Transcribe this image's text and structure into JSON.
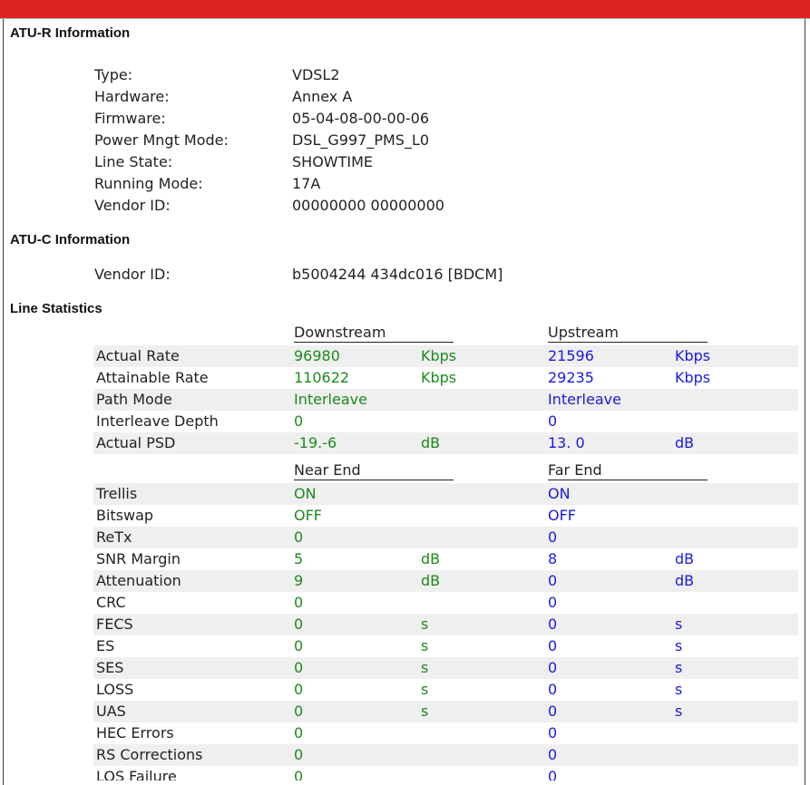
{
  "sections": {
    "atur_title": "ATU-R Information",
    "atuc_title": "ATU-C Information",
    "line_title": "Line Statistics"
  },
  "atur": [
    {
      "label": "Type:",
      "value": "VDSL2"
    },
    {
      "label": "Hardware:",
      "value": "Annex A"
    },
    {
      "label": "Firmware:",
      "value": "05-04-08-00-00-06"
    },
    {
      "label": "Power Mngt Mode:",
      "value": "DSL_G997_PMS_L0"
    },
    {
      "label": "Line State:",
      "value": "SHOWTIME"
    },
    {
      "label": "Running Mode:",
      "value": "17A"
    },
    {
      "label": "Vendor ID:",
      "value": "00000000 00000000"
    }
  ],
  "atuc": [
    {
      "label": "Vendor ID:",
      "value": "b5004244 434dc016 [BDCM]"
    }
  ],
  "stats_header1": {
    "left": "Downstream",
    "right": "Upstream"
  },
  "stats_rows1": [
    {
      "label": "Actual Rate",
      "v1": "96980",
      "u1": "Kbps",
      "v2": "21596",
      "u2": "Kbps"
    },
    {
      "label": "Attainable Rate",
      "v1": "110622",
      "u1": "Kbps",
      "v2": "29235",
      "u2": "Kbps"
    },
    {
      "label": "Path Mode",
      "v1": "Interleave",
      "u1": "",
      "v2": "Interleave",
      "u2": ""
    },
    {
      "label": "Interleave Depth",
      "v1": "0",
      "u1": "",
      "v2": "0",
      "u2": ""
    },
    {
      "label": "Actual PSD",
      "v1": "-19.-6",
      "u1": "dB",
      "v2": "13. 0",
      "u2": "dB"
    }
  ],
  "stats_header2": {
    "left": "Near End",
    "right": "Far End"
  },
  "stats_rows2": [
    {
      "label": "Trellis",
      "v1": "ON",
      "u1": "",
      "v2": "ON",
      "u2": ""
    },
    {
      "label": "Bitswap",
      "v1": "OFF",
      "u1": "",
      "v2": "OFF",
      "u2": ""
    },
    {
      "label": "ReTx",
      "v1": "0",
      "u1": "",
      "v2": "0",
      "u2": ""
    },
    {
      "label": "SNR Margin",
      "v1": "5",
      "u1": "dB",
      "v2": "8",
      "u2": "dB"
    },
    {
      "label": "Attenuation",
      "v1": "9",
      "u1": "dB",
      "v2": "0",
      "u2": "dB"
    },
    {
      "label": "CRC",
      "v1": "0",
      "u1": "",
      "v2": "0",
      "u2": ""
    },
    {
      "label": "FECS",
      "v1": "0",
      "u1": "s",
      "v2": "0",
      "u2": "s"
    },
    {
      "label": "ES",
      "v1": "0",
      "u1": "s",
      "v2": "0",
      "u2": "s"
    },
    {
      "label": "SES",
      "v1": "0",
      "u1": "s",
      "v2": "0",
      "u2": "s"
    },
    {
      "label": "LOSS",
      "v1": "0",
      "u1": "s",
      "v2": "0",
      "u2": "s"
    },
    {
      "label": "UAS",
      "v1": "0",
      "u1": "s",
      "v2": "0",
      "u2": "s"
    },
    {
      "label": "HEC Errors",
      "v1": "0",
      "u1": "",
      "v2": "0",
      "u2": ""
    },
    {
      "label": "RS Corrections",
      "v1": "0",
      "u1": "",
      "v2": "0",
      "u2": ""
    },
    {
      "label": "LOS Failure",
      "v1": "0",
      "u1": "",
      "v2": "0",
      "u2": ""
    }
  ]
}
